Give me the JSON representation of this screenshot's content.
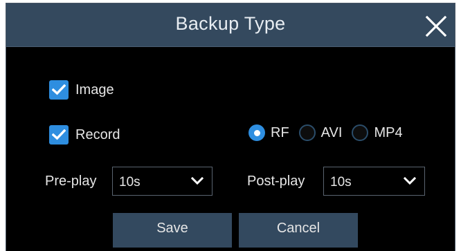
{
  "dialog": {
    "title": "Backup Type",
    "close_icon": "close-icon"
  },
  "options": {
    "image": {
      "label": "Image",
      "checked": true
    },
    "record": {
      "label": "Record",
      "checked": true
    }
  },
  "format": {
    "selected": "RF",
    "choices": [
      "RF",
      "AVI",
      "MP4"
    ]
  },
  "preplay": {
    "label": "Pre-play",
    "value": "10s"
  },
  "postplay": {
    "label": "Post-play",
    "value": "10s"
  },
  "buttons": {
    "save": "Save",
    "cancel": "Cancel"
  },
  "colors": {
    "accent": "#2e8ee0",
    "titlebar": "#34495e",
    "button": "#33495f",
    "background": "#000000"
  }
}
